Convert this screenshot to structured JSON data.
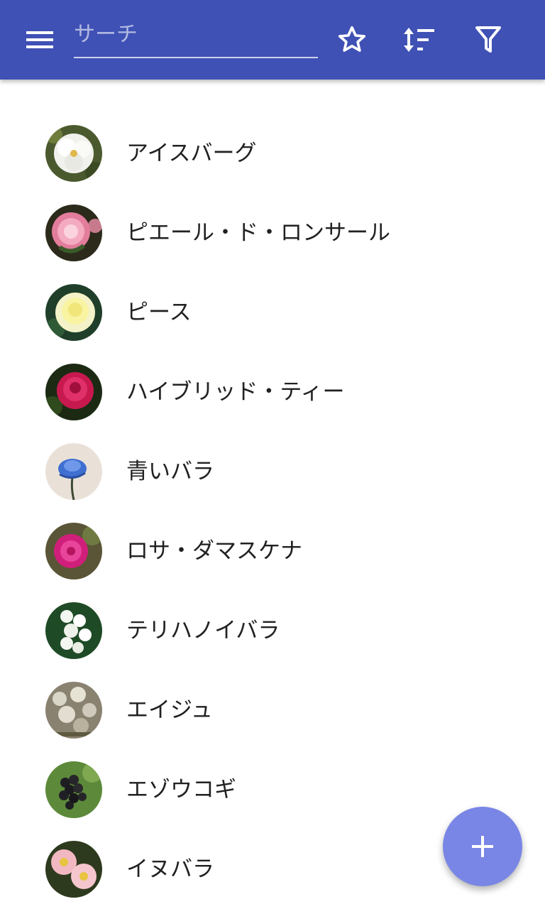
{
  "toolbar": {
    "search_placeholder": "サーチ",
    "search_value": "",
    "background_color": "#3f51b5",
    "icons": [
      "menu-icon",
      "star-icon",
      "sort-icon",
      "filter-icon"
    ]
  },
  "items": [
    {
      "label": "アイスバーグ",
      "thumb": "white-rose"
    },
    {
      "label": "ピエール・ド・ロンサール",
      "thumb": "pink-rose"
    },
    {
      "label": "ピース",
      "thumb": "yellow-rose"
    },
    {
      "label": "ハイブリッド・ティー",
      "thumb": "red-rose"
    },
    {
      "label": "青いバラ",
      "thumb": "blue-rose"
    },
    {
      "label": "ロサ・ダマスケナ",
      "thumb": "magenta-rose"
    },
    {
      "label": "テリハノイバラ",
      "thumb": "white-cluster-flower"
    },
    {
      "label": "エイジュ",
      "thumb": "white-shrub-flower"
    },
    {
      "label": "エゾウコギ",
      "thumb": "black-berries"
    },
    {
      "label": "イヌバラ",
      "thumb": "pale-pink-flower"
    }
  ],
  "fab": {
    "icon": "plus-icon",
    "color": "#7986e6"
  }
}
